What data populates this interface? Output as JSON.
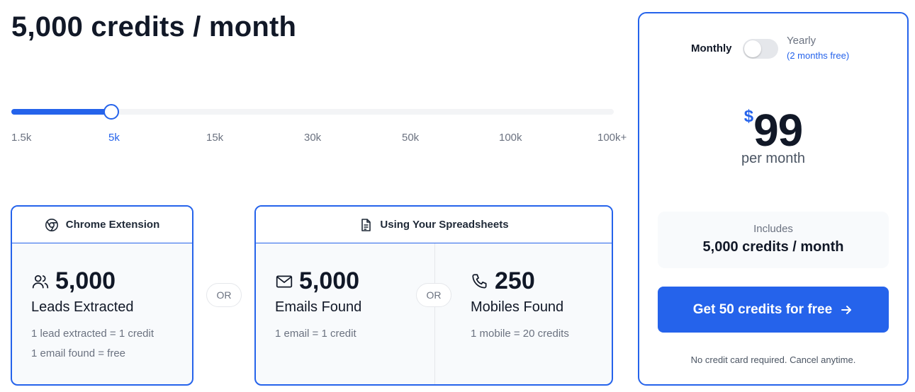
{
  "headline": "5,000 credits / month",
  "slider": {
    "ticks": [
      "1.5k",
      "5k",
      "15k",
      "30k",
      "50k",
      "100k",
      "100k+"
    ],
    "selected": "5k",
    "selected_index": 1
  },
  "chrome_card": {
    "title": "Chrome Extension",
    "icon": "chrome-icon",
    "value": "5,000",
    "label": "Leads Extracted",
    "note1": "1 lead extracted = 1 credit",
    "note2": "1 email found = free"
  },
  "or_label": "OR",
  "sheets_card": {
    "title": "Using Your Spreadsheets",
    "icon": "document-icon",
    "emails": {
      "value": "5,000",
      "label": "Emails Found",
      "note": "1 email = 1 credit",
      "icon": "mail-icon"
    },
    "mobiles": {
      "value": "250",
      "label": "Mobiles Found",
      "note": "1 mobile = 20 credits",
      "icon": "phone-icon"
    }
  },
  "pricing": {
    "monthly_label": "Monthly",
    "yearly_label": "Yearly",
    "yearly_note": "(2 months free)",
    "billing_yearly": false,
    "currency": "$",
    "amount": "99",
    "period": "per month",
    "includes_label": "Includes",
    "includes_value": "5,000 credits / month",
    "cta_label": "Get 50 credits for free",
    "fine_print": "No credit card required. Cancel anytime."
  },
  "colors": {
    "accent": "#2563eb",
    "text": "#111827",
    "muted": "#6b7280"
  }
}
